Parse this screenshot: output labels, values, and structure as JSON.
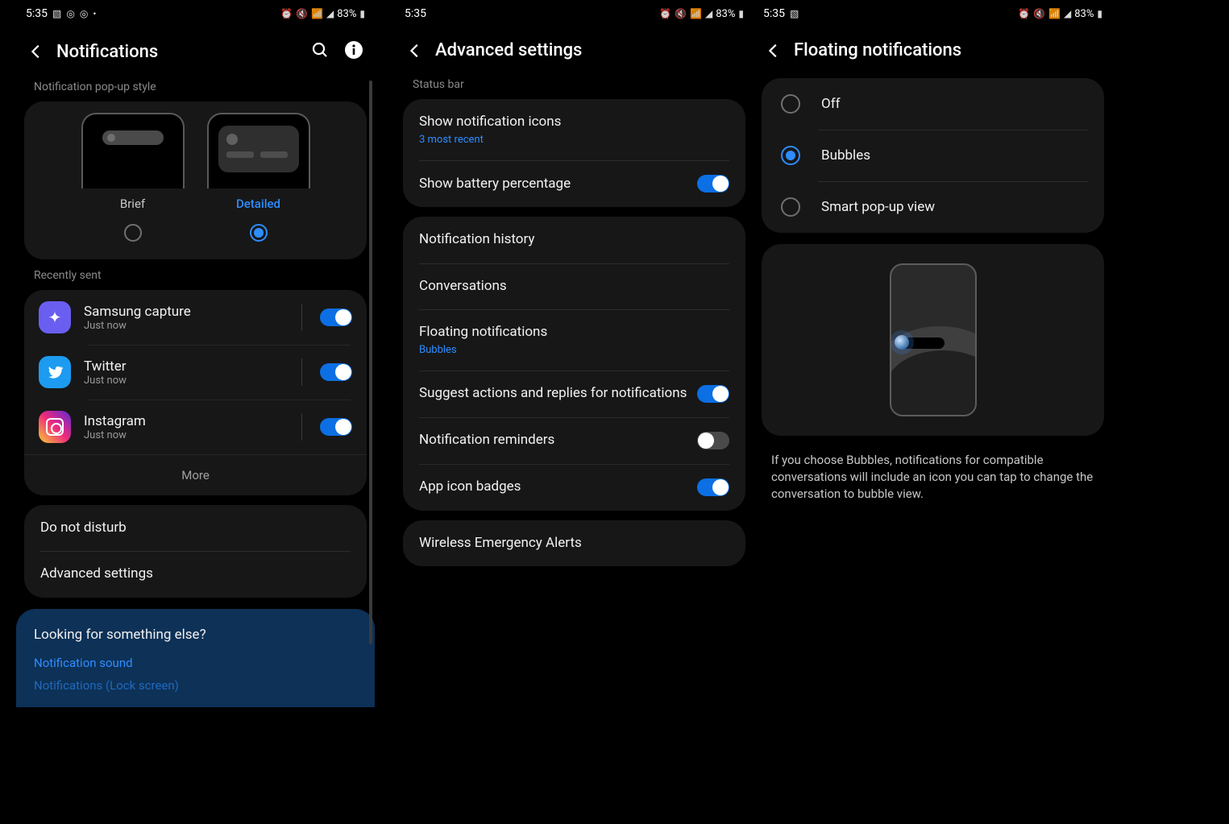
{
  "status": {
    "time": "5:35",
    "battery_text": "83%"
  },
  "screen1": {
    "title": "Notifications",
    "section_popup": "Notification pop-up style",
    "popup_options": {
      "brief": "Brief",
      "detailed": "Detailed"
    },
    "section_recent": "Recently sent",
    "apps": [
      {
        "name": "Samsung capture",
        "time": "Just now",
        "on": true
      },
      {
        "name": "Twitter",
        "time": "Just now",
        "on": true
      },
      {
        "name": "Instagram",
        "time": "Just now",
        "on": true
      }
    ],
    "more": "More",
    "dnd": "Do not disturb",
    "advanced": "Advanced settings",
    "footer": {
      "heading": "Looking for something else?",
      "link1": "Notification sound",
      "link2": "Notifications (Lock screen)"
    }
  },
  "screen2": {
    "title": "Advanced settings",
    "section_sb": "Status bar",
    "rows": {
      "show_icons": {
        "title": "Show notification icons",
        "sub": "3 most recent"
      },
      "show_batt": {
        "title": "Show battery percentage",
        "on": true
      },
      "history": {
        "title": "Notification history"
      },
      "convos": {
        "title": "Conversations"
      },
      "floating": {
        "title": "Floating notifications",
        "sub": "Bubbles"
      },
      "suggest": {
        "title": "Suggest actions and replies for notifications",
        "on": true
      },
      "reminders": {
        "title": "Notification reminders",
        "on": false
      },
      "badges": {
        "title": "App icon badges",
        "on": true
      },
      "wea": {
        "title": "Wireless Emergency Alerts"
      }
    }
  },
  "screen3": {
    "title": "Floating notifications",
    "options": {
      "off": "Off",
      "bubbles": "Bubbles",
      "smart": "Smart pop-up view"
    },
    "selected": "bubbles",
    "info": "If you choose Bubbles, notifications for compatible conversations will include an icon you can tap to change the conversation to bubble view."
  }
}
